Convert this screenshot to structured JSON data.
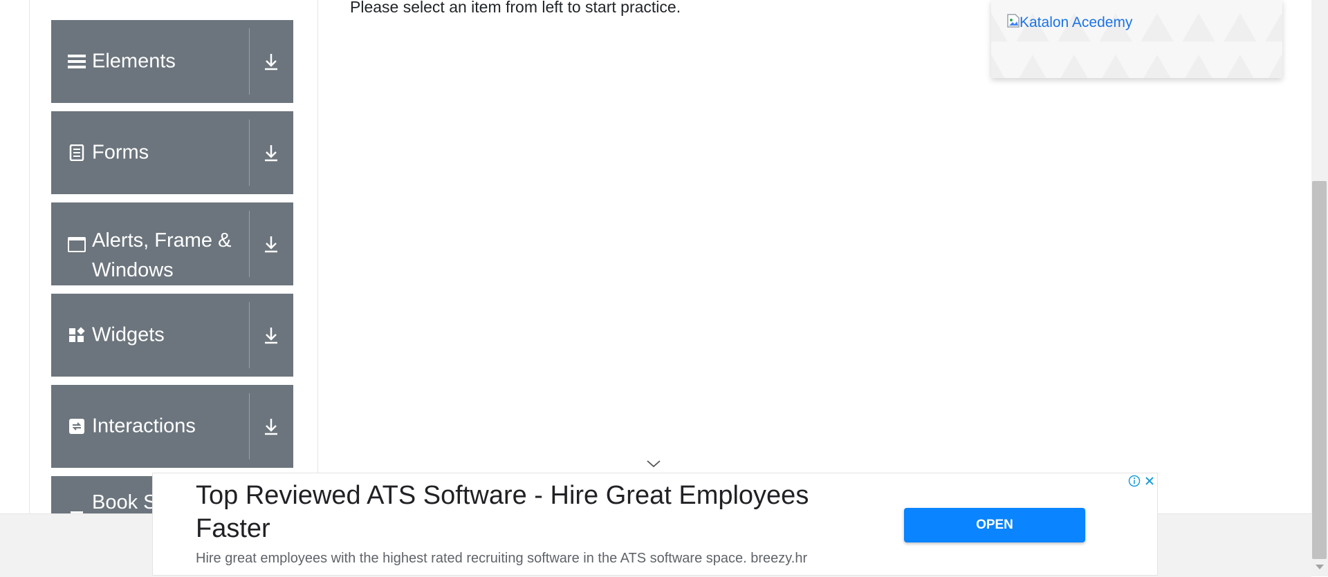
{
  "sidebar": {
    "groups": [
      {
        "label": "Elements",
        "icon": "hamburger-list-icon"
      },
      {
        "label": "Forms",
        "icon": "document-icon"
      },
      {
        "label": "Alerts, Frame & Windows",
        "icon": "browser-window-icon"
      },
      {
        "label": "Widgets",
        "icon": "widgets-icon"
      },
      {
        "label": "Interactions",
        "icon": "interactions-icon"
      },
      {
        "label": "Book Store Application",
        "icon": "book-icon"
      }
    ]
  },
  "main": {
    "message": "Please select an item from left to start practice."
  },
  "promo": {
    "link_text": "Katalon Acedemy",
    "image_alt": "Katalon Acedemy"
  },
  "ad": {
    "headline": "Top Reviewed ATS Software - Hire Great Employees Faster",
    "description": "Hire great employees with the highest rated recruiting software in the ATS software space. breezy.hr",
    "button_label": "OPEN"
  },
  "colors": {
    "sidebar_bg": "#6c757d",
    "ad_button": "#0a84ff",
    "link": "#1a73e8"
  }
}
